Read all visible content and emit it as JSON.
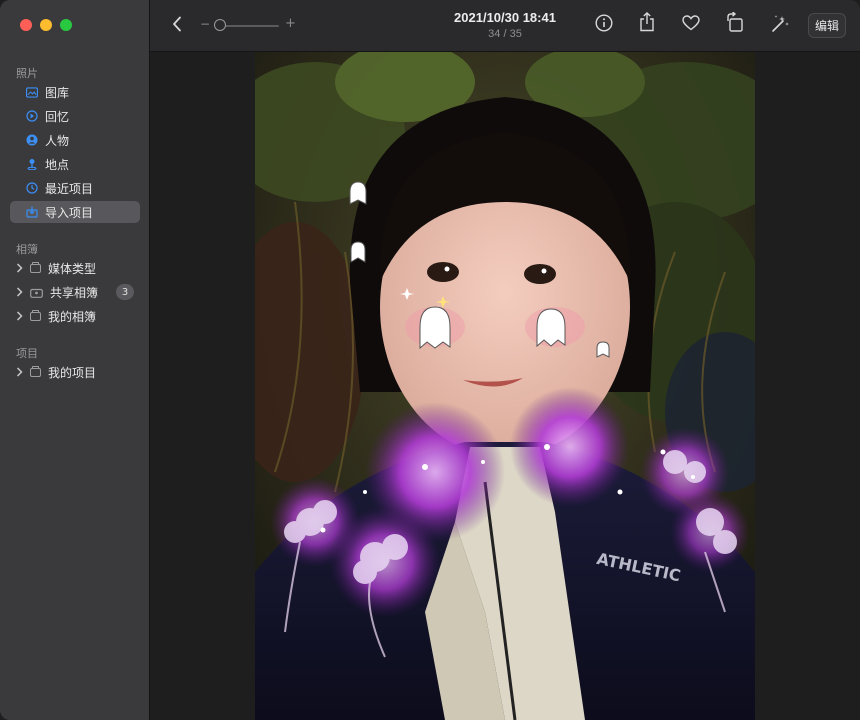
{
  "window": {
    "title": "2021/10/30 18:41",
    "subtitle": "34 / 35"
  },
  "toolbar": {
    "edit_label": "编辑",
    "zoom_minus": "−",
    "zoom_plus": "+",
    "zoom_level": 0.05,
    "icons": [
      "back-chevron-icon",
      "info-icon",
      "share-icon",
      "heart-icon",
      "rotate-icon",
      "magic-wand-icon"
    ]
  },
  "sidebar": {
    "sections": {
      "photos": "照片",
      "albums": "相簿",
      "projects": "项目"
    },
    "photo_items": [
      {
        "label": "图库",
        "icon": "photos-grid-icon"
      },
      {
        "label": "回忆",
        "icon": "memories-icon"
      },
      {
        "label": "人物",
        "icon": "people-icon"
      },
      {
        "label": "地点",
        "icon": "places-pin-icon"
      },
      {
        "label": "最近项目",
        "icon": "recents-clock-icon"
      },
      {
        "label": "导入项目",
        "icon": "import-icon",
        "selected": true
      }
    ],
    "album_items": [
      {
        "label": "媒体类型"
      },
      {
        "label": "共享相簿",
        "badge": "3"
      },
      {
        "label": "我的相簿"
      }
    ],
    "project_items": [
      {
        "label": "我的项目"
      }
    ]
  },
  "colors": {
    "sidebar_bg": "#3a3a3d",
    "toolbar_bg": "#2a2a2c",
    "content_bg": "#1e1e1e",
    "accent": "#3b8ff5",
    "selected_bg": "#58585c"
  }
}
